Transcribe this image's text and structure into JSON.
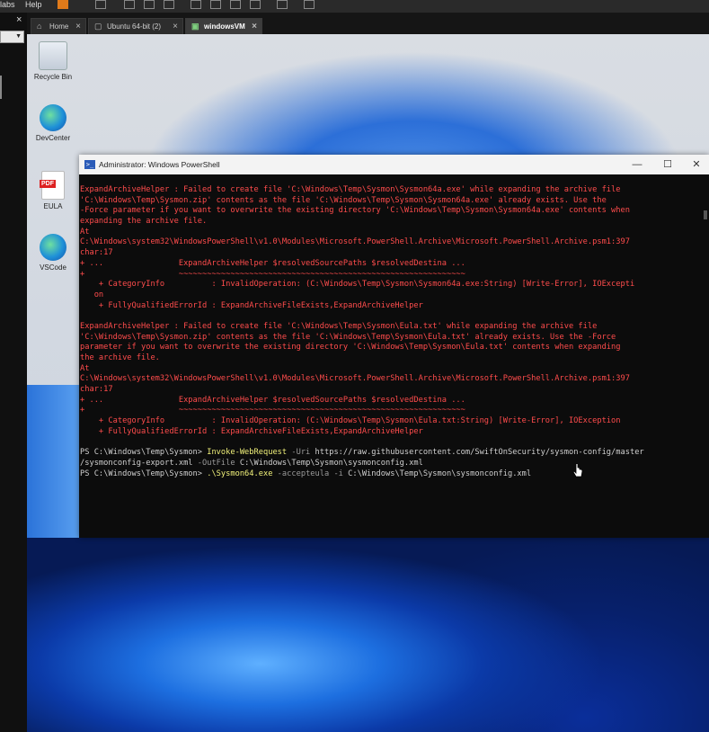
{
  "host": {
    "menu": [
      "labs",
      "Help"
    ],
    "close_glyph": "×",
    "tabs": [
      {
        "label": "Home",
        "icon": "home-icon",
        "active": false
      },
      {
        "label": "Ubuntu 64-bit (2)",
        "icon": "vm-icon",
        "active": false
      },
      {
        "label": "windowsVM",
        "icon": "vm-running-icon",
        "active": true
      }
    ]
  },
  "desktop": {
    "icons": [
      {
        "label": "Recycle Bin",
        "icon": "recycle-bin-icon"
      },
      {
        "label": "DevCenter",
        "icon": "edge-icon"
      },
      {
        "label": "EULA",
        "icon": "pdf-icon"
      },
      {
        "label": "VSCode",
        "icon": "edge-icon"
      }
    ]
  },
  "powershell": {
    "title": "Administrator: Windows PowerShell",
    "minimize": "—",
    "maximize": "☐",
    "close": "✕",
    "lines": [
      {
        "c": "r",
        "t": "ExpandArchiveHelper : Failed to create file 'C:\\Windows\\Temp\\Sysmon\\Sysmon64a.exe' while expanding the archive file"
      },
      {
        "c": "r",
        "t": "'C:\\Windows\\Temp\\Sysmon.zip' contents as the file 'C:\\Windows\\Temp\\Sysmon\\Sysmon64a.exe' already exists. Use the"
      },
      {
        "c": "r",
        "t": "-Force parameter if you want to overwrite the existing directory 'C:\\Windows\\Temp\\Sysmon\\Sysmon64a.exe' contents when"
      },
      {
        "c": "r",
        "t": "expanding the archive file."
      },
      {
        "c": "r",
        "t": "At"
      },
      {
        "c": "r",
        "t": "C:\\Windows\\system32\\WindowsPowerShell\\v1.0\\Modules\\Microsoft.PowerShell.Archive\\Microsoft.PowerShell.Archive.psm1:397"
      },
      {
        "c": "r",
        "t": "char:17"
      },
      {
        "c": "r",
        "t": "+ ...                ExpandArchiveHelper $resolvedSourcePaths $resolvedDestina ..."
      },
      {
        "c": "r",
        "t": "+                    ~~~~~~~~~~~~~~~~~~~~~~~~~~~~~~~~~~~~~~~~~~~~~~~~~~~~~~~~~~~~~"
      },
      {
        "c": "r",
        "t": "    + CategoryInfo          : InvalidOperation: (C:\\Windows\\Temp\\Sysmon\\Sysmon64a.exe:String) [Write-Error], IOExcepti"
      },
      {
        "c": "r",
        "t": "   on"
      },
      {
        "c": "r",
        "t": "    + FullyQualifiedErrorId : ExpandArchiveFileExists,ExpandArchiveHelper"
      },
      {
        "c": "r",
        "t": ""
      },
      {
        "c": "r",
        "t": "ExpandArchiveHelper : Failed to create file 'C:\\Windows\\Temp\\Sysmon\\Eula.txt' while expanding the archive file"
      },
      {
        "c": "r",
        "t": "'C:\\Windows\\Temp\\Sysmon.zip' contents as the file 'C:\\Windows\\Temp\\Sysmon\\Eula.txt' already exists. Use the -Force"
      },
      {
        "c": "r",
        "t": "parameter if you want to overwrite the existing directory 'C:\\Windows\\Temp\\Sysmon\\Eula.txt' contents when expanding"
      },
      {
        "c": "r",
        "t": "the archive file."
      },
      {
        "c": "r",
        "t": "At"
      },
      {
        "c": "r",
        "t": "C:\\Windows\\system32\\WindowsPowerShell\\v1.0\\Modules\\Microsoft.PowerShell.Archive\\Microsoft.PowerShell.Archive.psm1:397"
      },
      {
        "c": "r",
        "t": "char:17"
      },
      {
        "c": "r",
        "t": "+ ...                ExpandArchiveHelper $resolvedSourcePaths $resolvedDestina ..."
      },
      {
        "c": "r",
        "t": "+                    ~~~~~~~~~~~~~~~~~~~~~~~~~~~~~~~~~~~~~~~~~~~~~~~~~~~~~~~~~~~~~"
      },
      {
        "c": "r",
        "t": "    + CategoryInfo          : InvalidOperation: (C:\\Windows\\Temp\\Sysmon\\Eula.txt:String) [Write-Error], IOException"
      },
      {
        "c": "r",
        "t": "    + FullyQualifiedErrorId : ExpandArchiveFileExists,ExpandArchiveHelper"
      },
      {
        "c": "r",
        "t": ""
      },
      {
        "c": "cmd",
        "prompt": "PS C:\\Windows\\Temp\\Sysmon> ",
        "cmd": "Invoke-WebRequest",
        "p1": " -Uri ",
        "a1": "https://raw.githubusercontent.com/SwiftOnSecurity/sysmon-config/master"
      },
      {
        "c": "cmd2",
        "a1": "/sysmonconfig-export.xml",
        "p1": " -OutFile ",
        "a2": "C:\\Windows\\Temp\\Sysmon\\sysmonconfig.xml"
      },
      {
        "c": "cmd3",
        "prompt": "PS C:\\Windows\\Temp\\Sysmon> ",
        "cmd": ".\\Sysmon64.exe",
        "p1": " -accepteula -i ",
        "a1": "C:\\Windows\\Temp\\Sysmon\\sysmonconfig.xml"
      }
    ]
  },
  "colors": {
    "error": "#ff4c4c",
    "command": "#f1f17a",
    "param": "#9a9a9a",
    "text": "#d0d0d0"
  }
}
